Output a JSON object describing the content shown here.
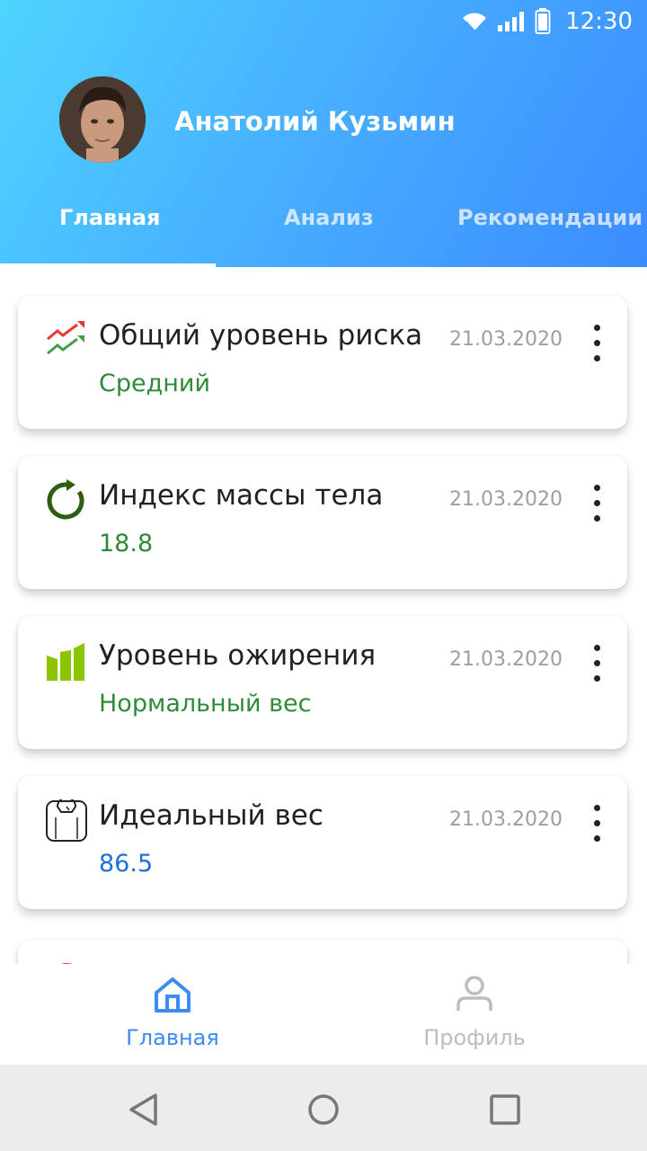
{
  "status_bar": {
    "time": "12:30",
    "icons": [
      "wifi-icon",
      "signal-icon",
      "battery-icon"
    ]
  },
  "header": {
    "user_name": "Анатолий Кузьмин",
    "tabs": [
      {
        "label": "Главная",
        "active": true
      },
      {
        "label": "Анализ",
        "active": false
      },
      {
        "label": "Рекомендации",
        "active": false
      }
    ]
  },
  "cards": [
    {
      "title": "Общий уровень риска",
      "date": "21.03.2020",
      "value": "Средний",
      "value_color": "#2e8b3a",
      "icon": "trend-arrows-icon"
    },
    {
      "title": "Индекс массы тела",
      "date": "21.03.2020",
      "value": "18.8",
      "value_color": "#2e8b3a",
      "icon": "refresh-circle-icon"
    },
    {
      "title": "Уровень ожирения",
      "date": "21.03.2020",
      "value": "Нормальный вес",
      "value_color": "#2e8b3a",
      "icon": "bars-icon"
    },
    {
      "title": "Идеальный вес",
      "date": "21.03.2020",
      "value": "86.5",
      "value_color": "#1f6fd6",
      "icon": "scale-icon"
    }
  ],
  "bottom_nav": [
    {
      "label": "Главная",
      "active": true,
      "icon": "home-icon"
    },
    {
      "label": "Профиль",
      "active": false,
      "icon": "person-icon"
    }
  ],
  "colors": {
    "active_nav": "#3d8bf2",
    "inactive_nav": "#bdbdbd",
    "accent_green": "#2e8b3a",
    "accent_blue": "#1f6fd6"
  }
}
